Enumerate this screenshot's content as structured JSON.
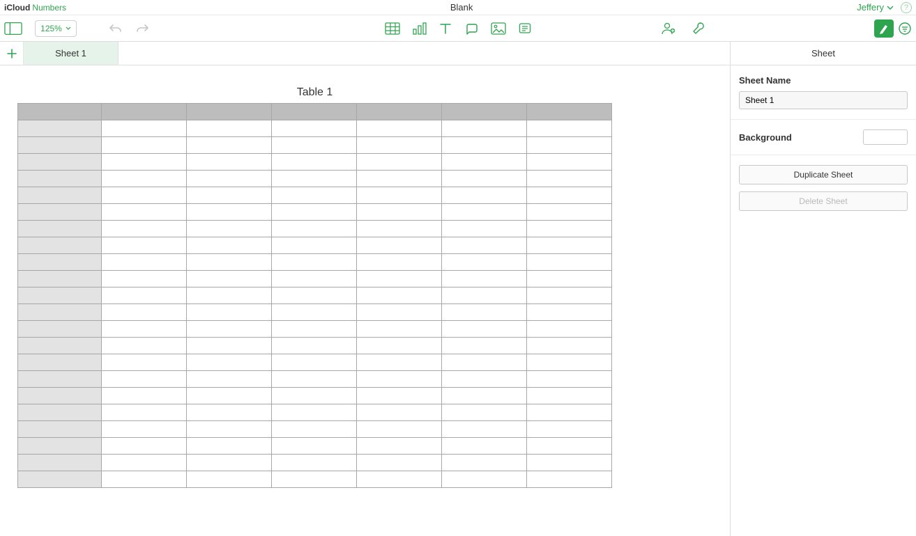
{
  "header": {
    "brand_primary": "iCloud",
    "brand_secondary": "Numbers",
    "document_title": "Blank",
    "user_name": "Jeffery",
    "help_glyph": "?"
  },
  "toolbar": {
    "zoom_value": "125%"
  },
  "tabs": {
    "sheets": [
      {
        "label": "Sheet 1"
      }
    ]
  },
  "table": {
    "title": "Table 1",
    "columns": 7,
    "rows": 22
  },
  "inspector": {
    "tab_label": "Sheet",
    "sheet_name_label": "Sheet Name",
    "sheet_name_value": "Sheet 1",
    "background_label": "Background",
    "background_color": "#ffffff",
    "duplicate_label": "Duplicate Sheet",
    "delete_label": "Delete Sheet"
  }
}
